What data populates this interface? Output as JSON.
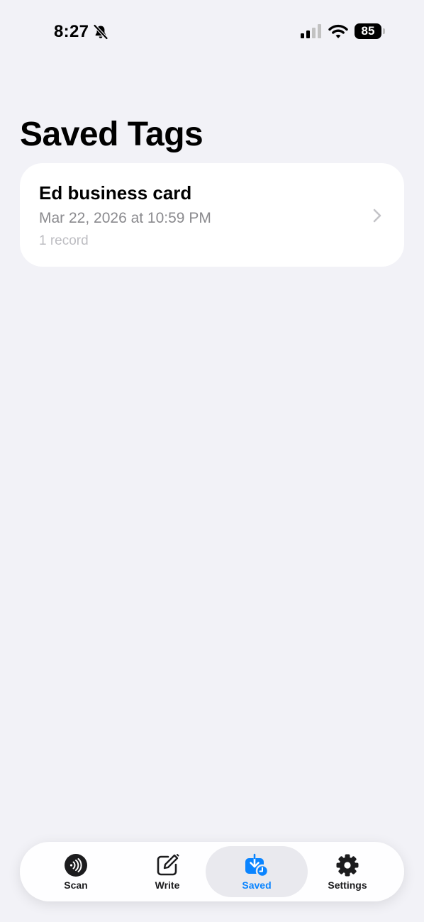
{
  "status_bar": {
    "time": "8:27",
    "battery_level": "85"
  },
  "page": {
    "title": "Saved Tags"
  },
  "saved_tags": [
    {
      "name": "Ed business card",
      "date": "Mar 22, 2026 at 10:59 PM",
      "records": "1 record"
    }
  ],
  "tab_bar": {
    "active_tab": "Saved",
    "tabs": [
      {
        "label": "Scan",
        "icon": "nfc-scan-icon"
      },
      {
        "label": "Write",
        "icon": "compose-icon"
      },
      {
        "label": "Saved",
        "icon": "tray-download-icon"
      },
      {
        "label": "Settings",
        "icon": "gear-icon"
      }
    ]
  },
  "colors": {
    "background": "#F2F2F7",
    "card": "#FFFFFF",
    "accent": "#0A84FF",
    "secondary_text": "#8A8A8E",
    "tertiary_text": "#BDBDC2"
  }
}
